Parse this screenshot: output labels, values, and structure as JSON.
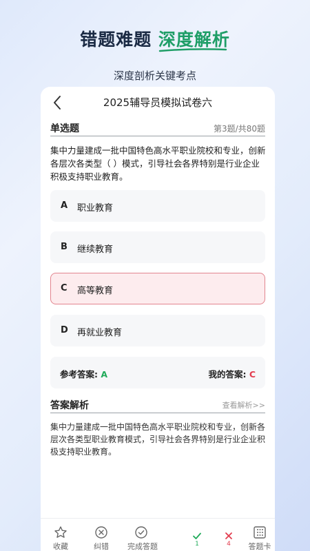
{
  "promo": {
    "title_dark": "错题难题",
    "title_accent": "深度解析",
    "subtitle": "深度剖析关键考点"
  },
  "header": {
    "title": "2025辅导员模拟试卷六"
  },
  "question": {
    "type_label": "单选题",
    "progress": "第3题/共80题",
    "text": "集中力量建成一批中国特色高水平职业院校和专业，创新各层次各类型（ ）模式，引导社会各界特别是行业企业积极支持职业教育。"
  },
  "options": [
    {
      "letter": "A",
      "text": "职业教育"
    },
    {
      "letter": "B",
      "text": "继续教育"
    },
    {
      "letter": "C",
      "text": "高等教育"
    },
    {
      "letter": "D",
      "text": "再就业教育"
    }
  ],
  "answers": {
    "reference_label": "参考答案:",
    "reference_value": "A",
    "mine_label": "我的答案:",
    "mine_value": "C"
  },
  "analysis": {
    "label": "答案解析",
    "link": "查看解析>>",
    "text": "集中力量建成一批中国特色高水平职业院校和专业，创新各层次各类型职业教育模式，引导社会各界特别是行业企业积极支持职业教育。"
  },
  "toolbar": {
    "favorite": "收藏",
    "report_error": "纠错",
    "finish": "完成答题",
    "correct_count": "1",
    "wrong_count": "4",
    "answer_card": "答题卡"
  },
  "colors": {
    "accent_green": "#1f9e67",
    "correct": "#1faa59",
    "wrong": "#e23c4e"
  }
}
